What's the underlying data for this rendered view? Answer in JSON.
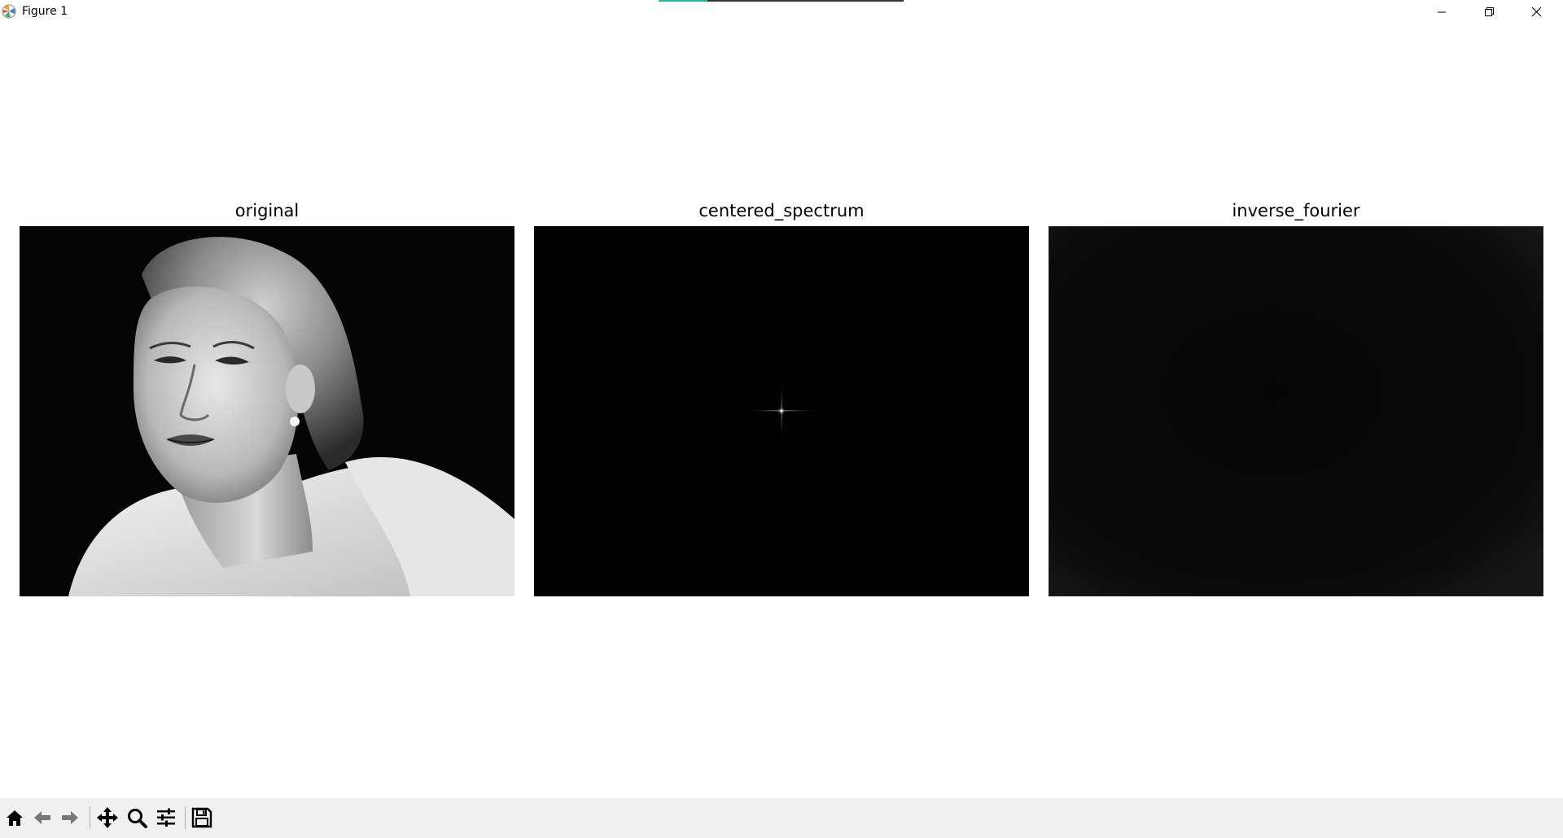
{
  "window": {
    "title": "Figure 1",
    "controls": [
      "minimize",
      "restore",
      "close"
    ]
  },
  "figure": {
    "panels": [
      {
        "title": "original",
        "content": "grayscale portrait photograph"
      },
      {
        "title": "centered_spectrum",
        "content": "black spectrum with bright center point"
      },
      {
        "title": "inverse_fourier",
        "content": "near-black reconstructed image"
      }
    ]
  },
  "toolbar": {
    "tools": [
      "home-icon",
      "back-icon",
      "forward-icon",
      "pan-icon",
      "zoom-icon",
      "configure-subplots-icon",
      "save-icon"
    ]
  }
}
